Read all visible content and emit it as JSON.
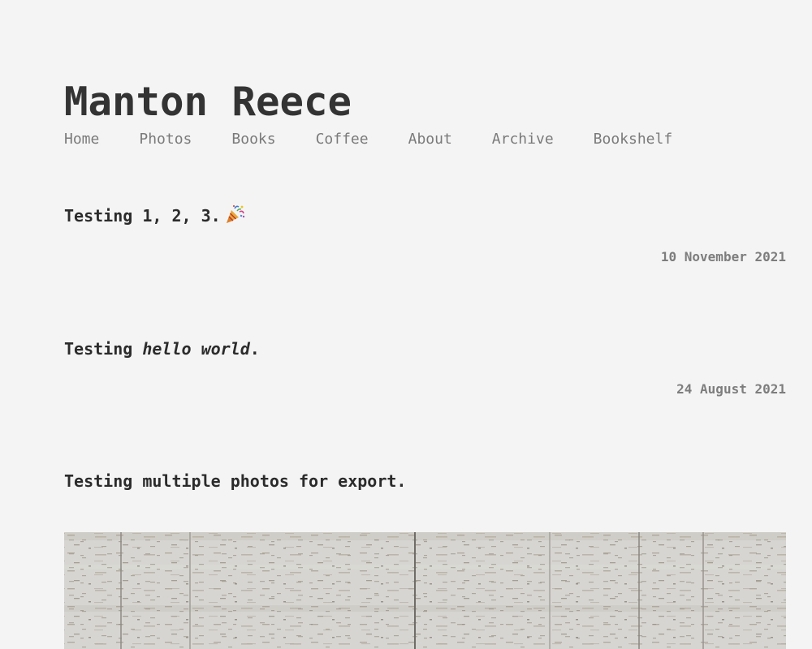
{
  "site": {
    "title": "Manton Reece"
  },
  "nav": {
    "items": [
      {
        "label": "Home"
      },
      {
        "label": "Photos"
      },
      {
        "label": "Books"
      },
      {
        "label": "Coffee"
      },
      {
        "label": "About"
      },
      {
        "label": "Archive"
      },
      {
        "label": "Bookshelf"
      }
    ]
  },
  "posts": [
    {
      "text": "Testing 1, 2, 3.",
      "icon": "party-popper-icon",
      "date": "10 November 2021"
    },
    {
      "text_before": "Testing ",
      "text_em": "hello world",
      "text_after": ".",
      "date": "24 August 2021"
    },
    {
      "text": "Testing multiple photos for export.",
      "image": "travertine-stone-wall-photo"
    }
  ],
  "colors": {
    "background": "#f4f4f4",
    "text": "#2b2b2b",
    "nav": "#7a7a7a",
    "date": "#7d7d7d"
  }
}
